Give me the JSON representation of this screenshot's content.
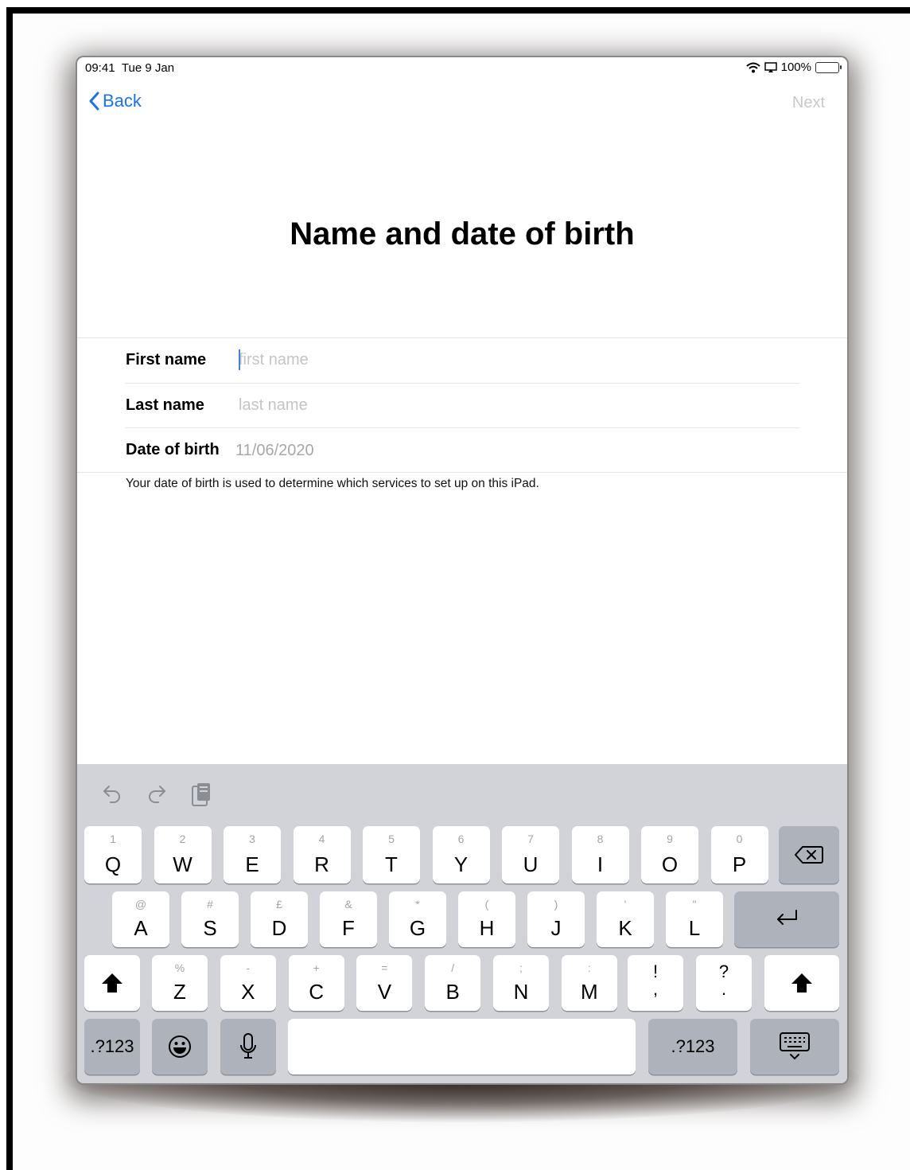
{
  "status_bar": {
    "time": "09:41",
    "date": "Tue 9 Jan",
    "battery": "100%"
  },
  "nav": {
    "back_label": "Back",
    "next_label": "Next"
  },
  "title": "Name and date of birth",
  "form": {
    "first_name": {
      "label": "First name",
      "placeholder": "first name",
      "value": ""
    },
    "last_name": {
      "label": "Last name",
      "placeholder": "last name",
      "value": ""
    },
    "date_of_birth": {
      "label": "Date of birth",
      "value": "11/06/2020"
    }
  },
  "note": "Your date of birth is used to determine which services to set up on this iPad.",
  "keyboard": {
    "row1": [
      {
        "main": "Q",
        "alt": "1"
      },
      {
        "main": "W",
        "alt": "2"
      },
      {
        "main": "E",
        "alt": "3"
      },
      {
        "main": "R",
        "alt": "4"
      },
      {
        "main": "T",
        "alt": "5"
      },
      {
        "main": "Y",
        "alt": "6"
      },
      {
        "main": "U",
        "alt": "7"
      },
      {
        "main": "I",
        "alt": "8"
      },
      {
        "main": "O",
        "alt": "9"
      },
      {
        "main": "P",
        "alt": "0"
      }
    ],
    "row2": [
      {
        "main": "A",
        "alt": "@"
      },
      {
        "main": "S",
        "alt": "#"
      },
      {
        "main": "D",
        "alt": "£"
      },
      {
        "main": "F",
        "alt": "&"
      },
      {
        "main": "G",
        "alt": "*"
      },
      {
        "main": "H",
        "alt": "("
      },
      {
        "main": "J",
        "alt": ")"
      },
      {
        "main": "K",
        "alt": "'"
      },
      {
        "main": "L",
        "alt": "\""
      }
    ],
    "row3": [
      {
        "main": "Z",
        "alt": "%"
      },
      {
        "main": "X",
        "alt": "-"
      },
      {
        "main": "C",
        "alt": "+"
      },
      {
        "main": "V",
        "alt": "="
      },
      {
        "main": "B",
        "alt": "/"
      },
      {
        "main": "N",
        "alt": ";"
      },
      {
        "main": "M",
        "alt": ":"
      }
    ],
    "punct1": {
      "top": "!",
      "bottom": ","
    },
    "punct2": {
      "top": "?",
      "bottom": "."
    },
    "numbers_label": ".?123",
    "icons": {
      "undo": "undo-icon",
      "redo": "redo-icon",
      "paste": "paste-icon",
      "delete": "backspace-icon",
      "return": "return-icon",
      "shift": "shift-icon",
      "emoji": "emoji-icon",
      "mic": "microphone-icon",
      "dismiss": "keyboard-dismiss-icon"
    }
  }
}
